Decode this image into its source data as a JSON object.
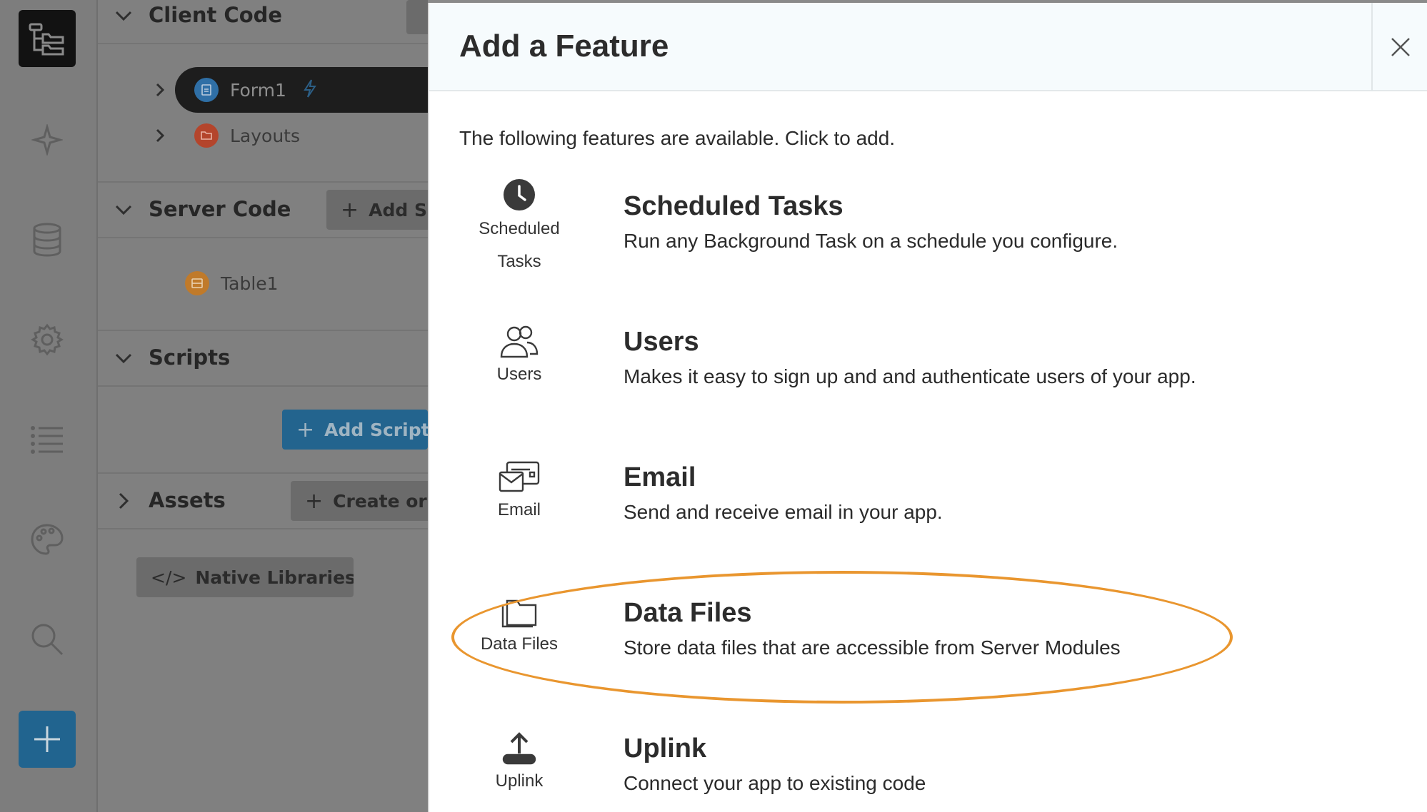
{
  "rail": {
    "icons": [
      "app-tree-icon",
      "star-icon",
      "database-icon",
      "gear-icon",
      "list-icon",
      "palette-icon",
      "search-icon",
      "plus-icon"
    ]
  },
  "tree": {
    "client_code": {
      "title": "Client Code",
      "items": [
        {
          "label": "Form1",
          "icon": "form-icon",
          "color": "#2f6fa6"
        },
        {
          "label": "Layouts",
          "icon": "folder-icon",
          "color": "#b4452c"
        }
      ]
    },
    "server_code": {
      "title": "Server Code",
      "add_label": "Add Se",
      "items": [
        {
          "label": "Table1",
          "icon": "table-icon",
          "color": "#c07a2a"
        }
      ]
    },
    "scripts": {
      "title": "Scripts",
      "add_label": "Add Script"
    },
    "assets": {
      "title": "Assets",
      "create_label": "Create or u"
    },
    "native_libraries_label": "Native Libraries..."
  },
  "modal": {
    "title": "Add a Feature",
    "intro": "The following features are available. Click to add.",
    "features": [
      {
        "icon": "clock-icon",
        "icon_label": "Scheduled Tasks",
        "title": "Scheduled Tasks",
        "description": "Run any Background Task on a schedule you configure."
      },
      {
        "icon": "users-icon",
        "icon_label": "Users",
        "title": "Users",
        "description": "Makes it easy to sign up and and authenticate users of your app."
      },
      {
        "icon": "email-icon",
        "icon_label": "Email",
        "title": "Email",
        "description": "Send and receive email in your app."
      },
      {
        "icon": "folder-icon",
        "icon_label": "Data Files",
        "title": "Data Files",
        "description": "Store data files that are accessible from Server Modules"
      },
      {
        "icon": "upload-icon",
        "icon_label": "Uplink",
        "title": "Uplink",
        "description": "Connect your app to existing code"
      }
    ],
    "highlight_color": "#e9962f"
  },
  "colors": {
    "accent": "#23648e",
    "overlay": "#808080",
    "modal_header_bg": "#f6fbfd"
  }
}
